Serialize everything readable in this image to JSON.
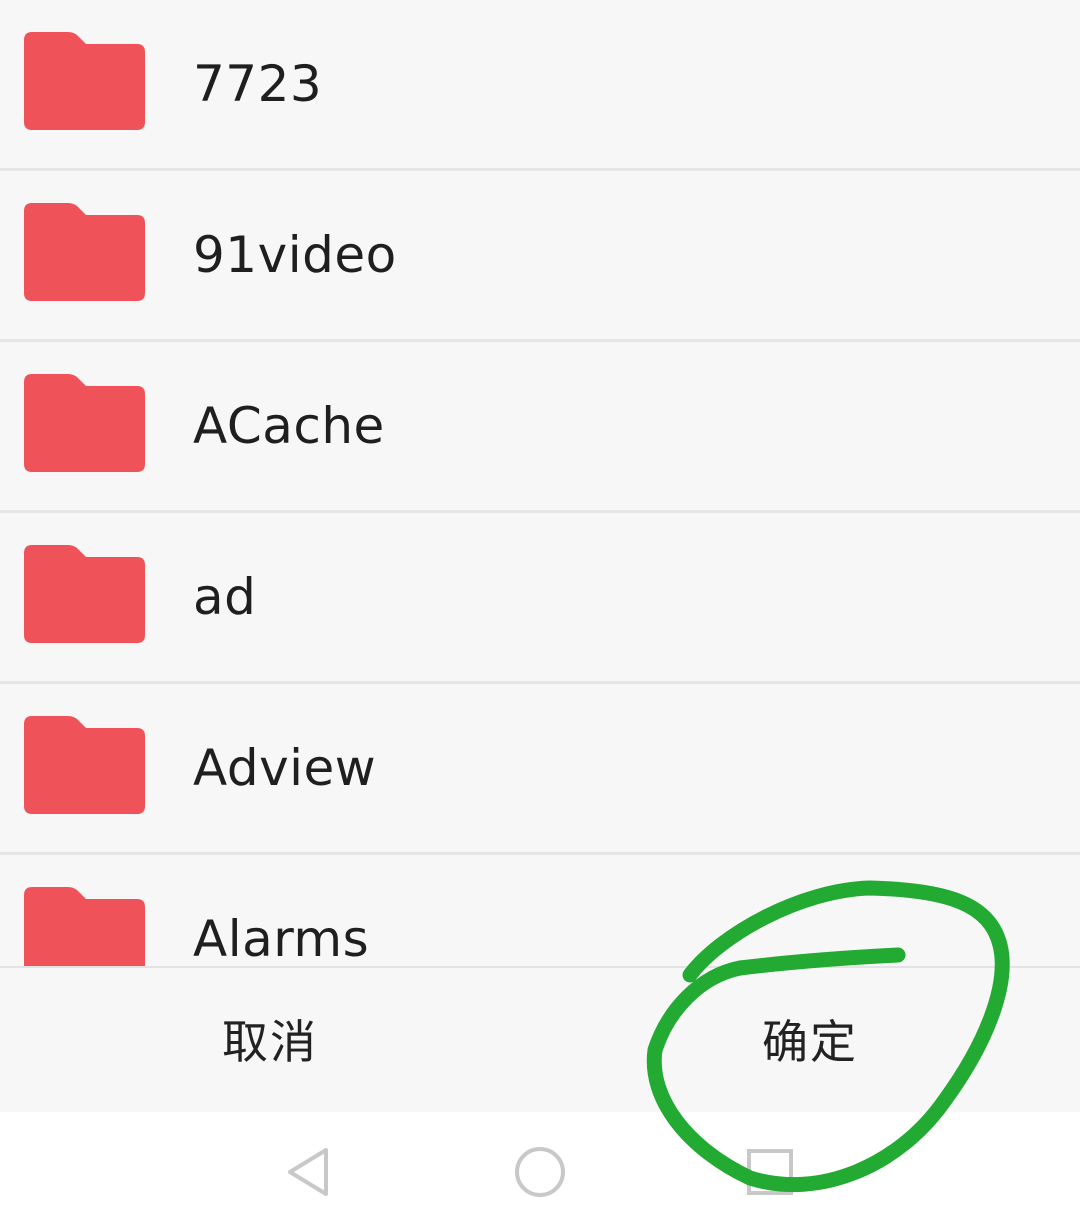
{
  "colors": {
    "folder": "#f0525a",
    "folder_tab": "#ee4b55",
    "annotation": "#22aa33",
    "nav_icon": "#c8c8c8"
  },
  "folders": [
    {
      "name": "7723",
      "icon": "folder-icon"
    },
    {
      "name": "91video",
      "icon": "folder-icon"
    },
    {
      "name": "ACache",
      "icon": "folder-icon"
    },
    {
      "name": "ad",
      "icon": "folder-icon"
    },
    {
      "name": "Adview",
      "icon": "folder-icon"
    },
    {
      "name": "Alarms",
      "icon": "folder-icon"
    }
  ],
  "actions": {
    "cancel_label": "取消",
    "confirm_label": "确定"
  },
  "nav": {
    "back_icon": "back-triangle-icon",
    "home_icon": "home-circle-icon",
    "recents_icon": "recents-square-icon"
  }
}
